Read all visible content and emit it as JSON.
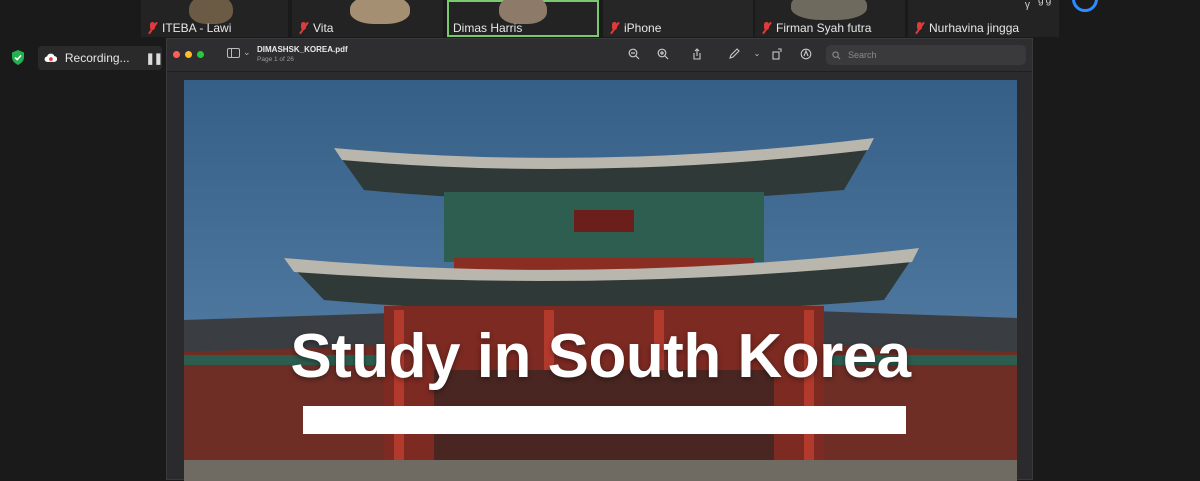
{
  "participants": [
    {
      "name": "ITEBA - Lawi"
    },
    {
      "name": "Vita"
    },
    {
      "name": "Dimas Harris"
    },
    {
      "name": "iPhone"
    },
    {
      "name": "Firman Syah futra"
    },
    {
      "name": "Nurhavina jingga"
    }
  ],
  "top_right_text": "ᵧ ᵍᵍ",
  "recording": {
    "label": "Recording..."
  },
  "viewer": {
    "doc_title": "DIMASHSK_KOREA.pdf",
    "page_info": "Page 1 of 26",
    "search_placeholder": "Search"
  },
  "page": {
    "headline": "Study in South Korea"
  },
  "colors": {
    "accent": "#2d8cff",
    "active_speaker": "#7bc96f",
    "muted_mic": "#e03b3b"
  }
}
